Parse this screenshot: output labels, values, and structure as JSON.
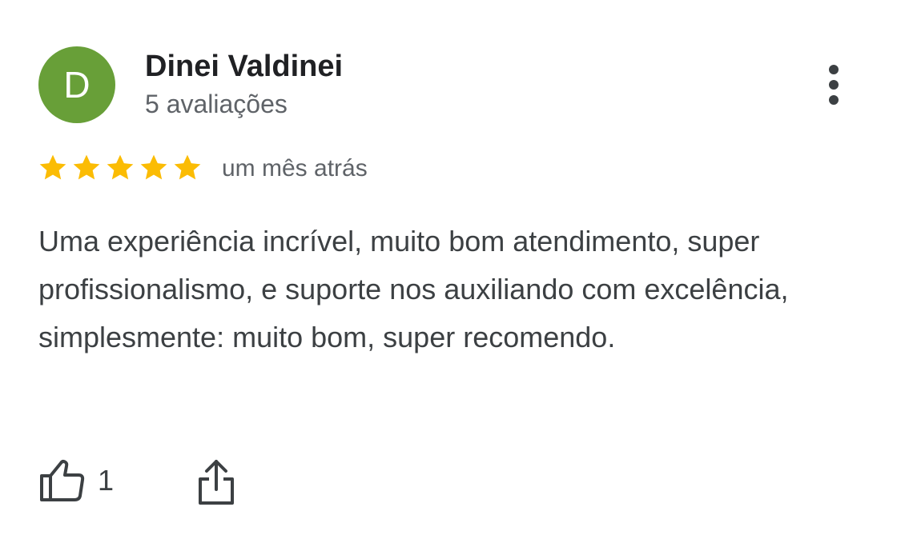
{
  "review": {
    "author": {
      "initial": "D",
      "name": "Dinei Valdinei",
      "meta": "5 avaliações",
      "avatar_color": "#689f38"
    },
    "rating": {
      "stars": 5,
      "max": 5,
      "star_color": "#fbbc04"
    },
    "time": "um mês atrás",
    "text": "Uma experiência incrível, muito bom atendimento, super profissionalismo, e suporte nos auxiliando com excelência, simplesmente: muito bom, super recomendo.",
    "actions": {
      "like_icon": "thumbs-up-icon",
      "like_count": "1",
      "share_icon": "share-icon",
      "more_icon": "more-vert-icon"
    }
  }
}
